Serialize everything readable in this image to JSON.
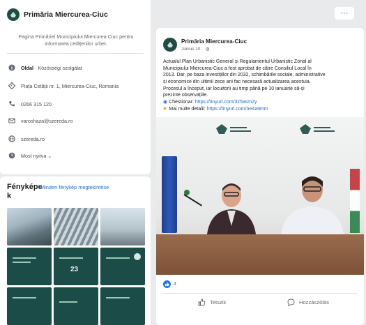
{
  "page": {
    "name": "Primăria Miercurea-Ciuc",
    "description": "Pagina Primăriei Municipiului Miercurea Ciuc pentru informarea cetățenilor urbei."
  },
  "info": {
    "category_prefix": "Oldal",
    "category": "Közösségi szolgálat",
    "address": "Piața Cetății nr. 1, Miercurea-Ciuc, Romania",
    "phone": "0266 315 120",
    "email": "varoshaza@szereda.ro",
    "website": "szereda.ro",
    "rating": "Most nyitva"
  },
  "photos": {
    "title": "Fényképe k",
    "see_all": "Minden fénykép megtekintése",
    "thumb_number": "23"
  },
  "post": {
    "author": "Primăria Miercurea-Ciuc",
    "time": "Június 10. · ",
    "lines": [
      "Actualul Plan Urbanistic General și Regulamentul Urbanistic Zonal al",
      "Municipiului Miercurea-Ciuc a fost aprobat de către Consiliul Local în",
      "2013. Dar, pe baza investițiilor din 2032, schimbările sociale, administrative",
      "și economice din ultimii zece ani fac necesară actualizarea acestuia.",
      "Procesul a început, iar locuitorii au timp până pe 10 ianuarie să-și",
      "prezinte observațiile."
    ],
    "survey_label": "Chestionar:",
    "survey_link": "https://tinyurl.com/3z5asm2y",
    "more_label": "Mai multe detalii:",
    "more_link": "https://tinyurl.com/ne4a9mm",
    "reaction_count": "4",
    "like_label": "Tetszik",
    "comment_label": "Hozzászólás"
  },
  "menu_glyph": "···",
  "colors": {
    "brand": "#1f4d46",
    "link": "#216fdb",
    "like": "#1877f2"
  }
}
